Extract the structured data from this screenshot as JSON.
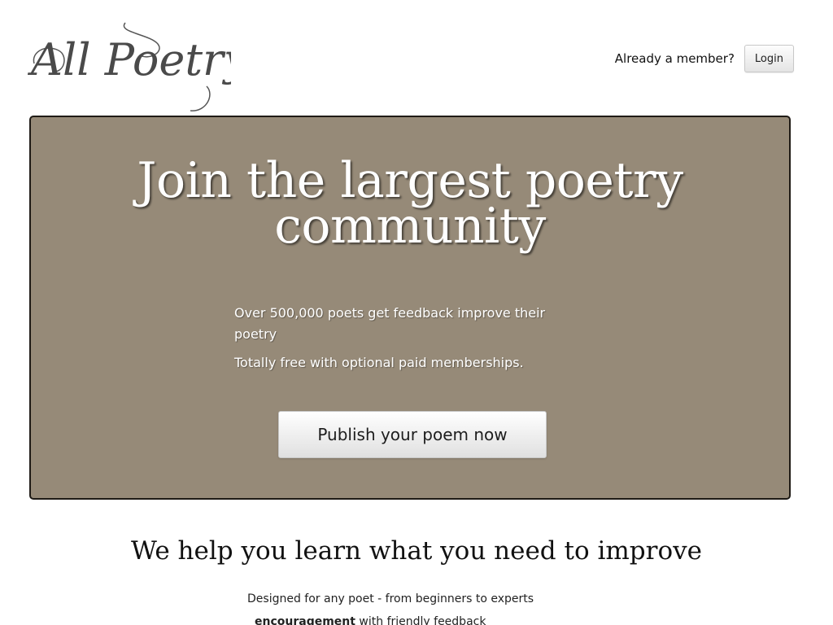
{
  "header": {
    "logo_text": "All Poetry",
    "member_prompt": "Already a member?",
    "login_label": "Login"
  },
  "hero": {
    "title": "Join the largest poetry community",
    "line1": "Over 500,000 poets get feedback improve their poetry",
    "line2": "Totally free with optional paid memberships.",
    "cta_label": "Publish your poem now",
    "background_color": "#968a78"
  },
  "section": {
    "heading": "We help you learn what you need to improve",
    "intro": "Designed for any poet - from beginners to experts",
    "feature_bold": "encouragement",
    "feature_rest": " with friendly feedback"
  }
}
